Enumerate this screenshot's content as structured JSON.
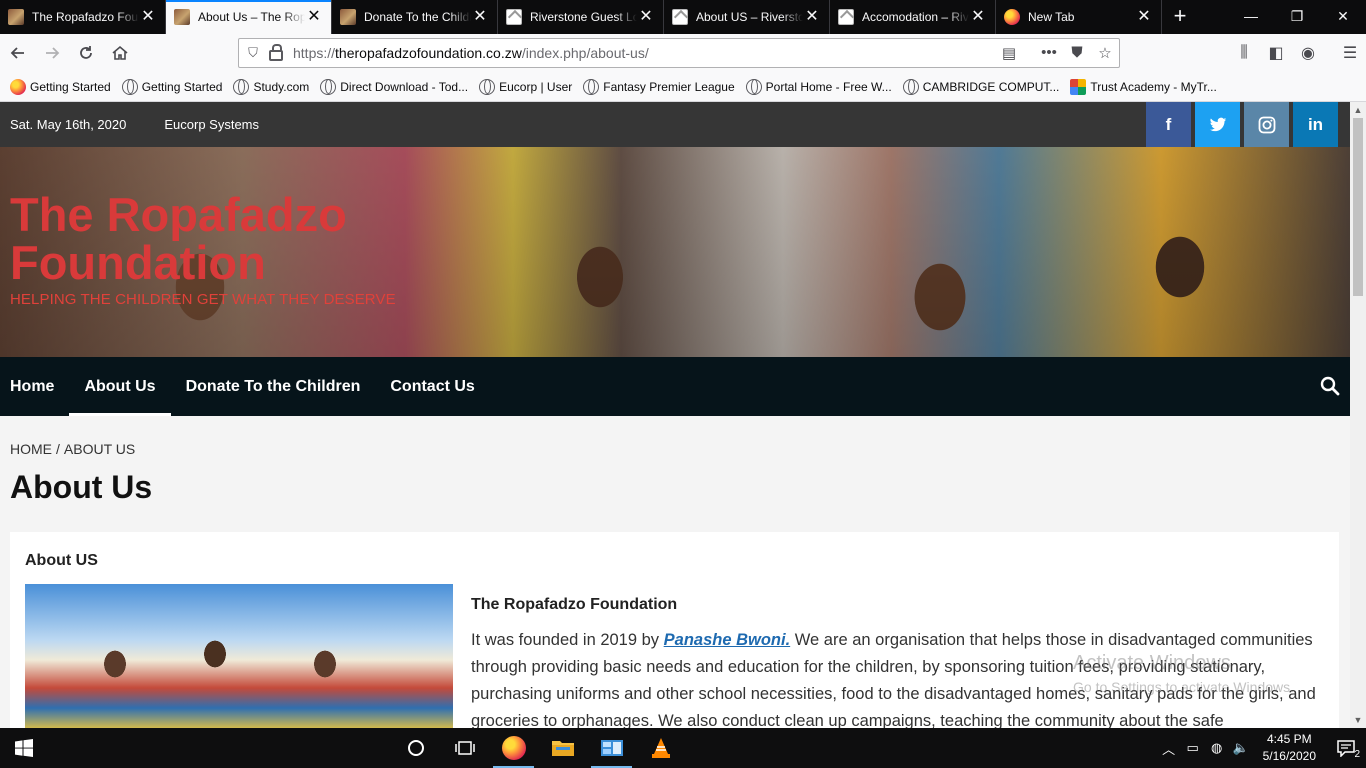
{
  "browser": {
    "tabs": [
      {
        "title": "The Ropafadzo Foundation",
        "icon": "ropafadzo-favicon",
        "active": false
      },
      {
        "title": "About Us – The Ropafadzo",
        "icon": "ropafadzo-favicon",
        "active": true
      },
      {
        "title": "Donate To the Children",
        "icon": "ropafadzo-favicon",
        "active": false
      },
      {
        "title": "Riverstone Guest Lodge",
        "icon": "riverstone-favicon",
        "active": false
      },
      {
        "title": "About US – Riverstone",
        "icon": "riverstone-favicon",
        "active": false
      },
      {
        "title": "Accomodation – Riverstone",
        "icon": "riverstone-favicon",
        "active": false
      },
      {
        "title": "New Tab",
        "icon": "firefox-icon",
        "active": false
      }
    ],
    "url": {
      "scheme": "https://",
      "host": "theropafadzofoundation.co.zw",
      "path": "/index.php/about-us/"
    },
    "bookmarks": [
      {
        "label": "Getting Started",
        "icon": "firefox-icon"
      },
      {
        "label": "Getting Started",
        "icon": "globe-icon"
      },
      {
        "label": "Study.com",
        "icon": "globe-icon"
      },
      {
        "label": "Direct Download - Tod...",
        "icon": "globe-icon"
      },
      {
        "label": "Eucorp | User",
        "icon": "globe-icon"
      },
      {
        "label": "Fantasy Premier League",
        "icon": "globe-icon"
      },
      {
        "label": "Portal Home - Free W...",
        "icon": "globe-icon"
      },
      {
        "label": "CAMBRIDGE COMPUT...",
        "icon": "globe-icon"
      },
      {
        "label": "Trust Academy - MyTr...",
        "icon": "trust-academy-icon"
      }
    ]
  },
  "site": {
    "topbar": {
      "date": "Sat. May 16th, 2020",
      "company": "Eucorp Systems"
    },
    "socials": [
      {
        "name": "facebook",
        "glyph": "f",
        "color": "#3b5998"
      },
      {
        "name": "twitter",
        "glyph": "🐦",
        "color": "#1da1f2"
      },
      {
        "name": "instagram",
        "glyph": "◎",
        "color": "#5a86a8"
      },
      {
        "name": "linkedin",
        "glyph": "in",
        "color": "#0a78b5"
      }
    ],
    "title": "The Ropafadzo Foundation",
    "tagline": "HELPING THE CHILDREN GET WHAT THEY DESERVE",
    "nav": [
      {
        "label": "Home",
        "current": false
      },
      {
        "label": "About Us",
        "current": true
      },
      {
        "label": "Donate To the Children",
        "current": false
      },
      {
        "label": "Contact Us",
        "current": false
      }
    ],
    "breadcrumb": {
      "home": "HOME",
      "separator": "/",
      "current": "ABOUT US"
    },
    "page_title": "About Us",
    "card": {
      "title": "About US",
      "heading": "The Ropafadzo Foundation",
      "text_before": "It was founded in 2019 by ",
      "founder": "Panashe Bwoni.",
      "text_after": " We are an organisation that helps those in disadvantaged communities through providing basic needs and education for the children, by sponsoring tuition fees, providing stationary, purchasing uniforms and other school necessities, food to the disadvantaged homes, sanitary pads for the girls, and groceries to orphanages. We also conduct clean up campaigns, teaching the community about the safe"
    },
    "accent_color": "#d93a3a",
    "nav_bg": "#06141a"
  },
  "watermark": {
    "line1": "Activate Windows",
    "line2": "Go to Settings to activate Windows."
  },
  "taskbar": {
    "apps": [
      "cortana-icon",
      "task-view-icon",
      "firefox-icon",
      "file-explorer-icon",
      "control-panel-icon",
      "vlc-icon"
    ],
    "time": "4:45 PM",
    "date": "5/16/2020",
    "notifications": "2"
  }
}
